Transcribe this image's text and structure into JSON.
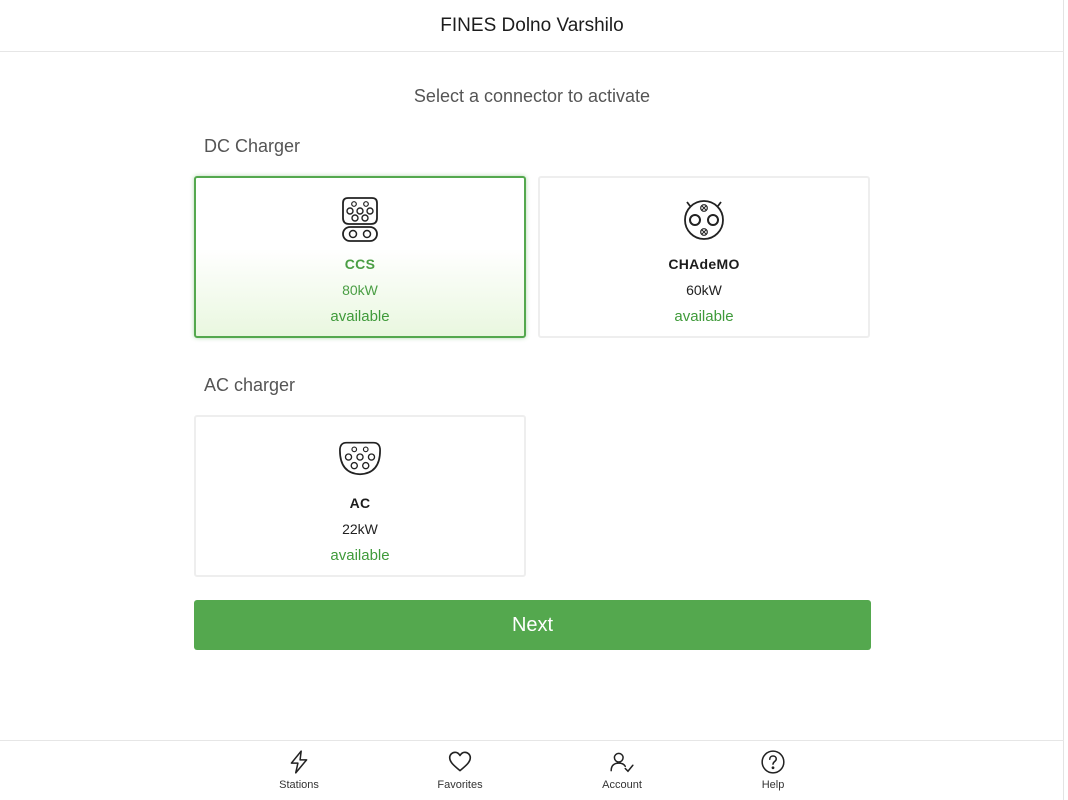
{
  "header": {
    "title": "FINES Dolno Varshilo"
  },
  "main": {
    "subtitle": "Select a connector to activate",
    "sections": [
      {
        "label": "DC Charger",
        "connectors": [
          {
            "name": "CCS",
            "power": "80kW",
            "status": "available",
            "icon": "ccs-connector-icon",
            "selected": true
          },
          {
            "name": "CHAdeMO",
            "power": "60kW",
            "status": "available",
            "icon": "chademo-connector-icon",
            "selected": false
          }
        ]
      },
      {
        "label": "AC charger",
        "connectors": [
          {
            "name": "AC",
            "power": "22kW",
            "status": "available",
            "icon": "type2-connector-icon",
            "selected": false
          }
        ]
      }
    ],
    "next_label": "Next"
  },
  "colors": {
    "accent": "#54a84e",
    "status_available": "#3f9a3a",
    "selected_bg": "#e9f7df"
  },
  "bottom_nav": {
    "items": [
      {
        "label": "Stations",
        "icon": "lightning-icon"
      },
      {
        "label": "Favorites",
        "icon": "heart-icon"
      },
      {
        "label": "Account",
        "icon": "account-check-icon"
      },
      {
        "label": "Help",
        "icon": "help-icon"
      }
    ]
  }
}
